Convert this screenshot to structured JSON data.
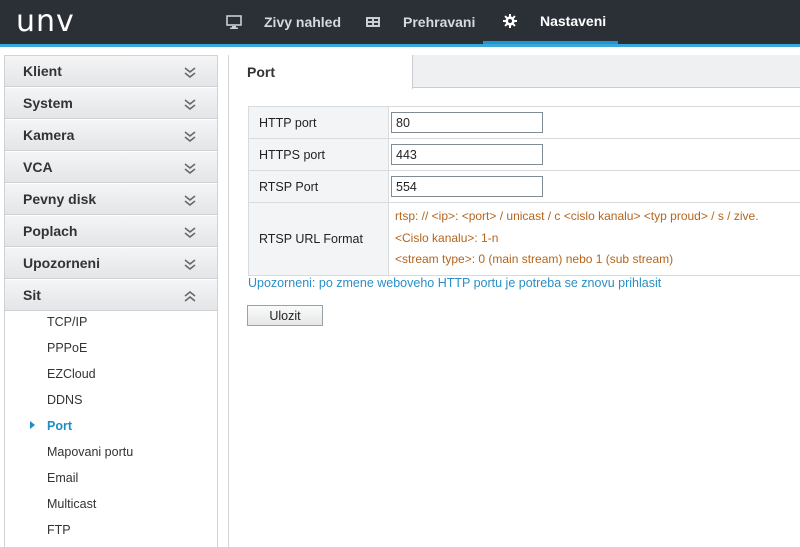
{
  "brand": {
    "logo": "unv"
  },
  "nav": [
    {
      "label": "Zivy nahled",
      "icon": "monitor-icon"
    },
    {
      "label": "Prehravani",
      "icon": "playback-icon"
    },
    {
      "label": "Nastaveni",
      "icon": "gear-icon",
      "active": true
    }
  ],
  "sidebar": {
    "menus": [
      "Klient",
      "System",
      "Kamera",
      "VCA",
      "Pevny disk",
      "Poplach",
      "Upozorneni",
      "Sit"
    ],
    "expanded": "Sit",
    "submenu": [
      "TCP/IP",
      "PPPoE",
      "EZCloud",
      "DDNS",
      "Port",
      "Mapovani portu",
      "Email",
      "Multicast",
      "FTP"
    ],
    "active_submenu": "Port"
  },
  "tab": {
    "label": "Port"
  },
  "form": {
    "http_label": "HTTP port",
    "http_value": "80",
    "https_label": "HTTPS port",
    "https_value": "443",
    "rtsp_label": "RTSP Port",
    "rtsp_value": "554",
    "rtsp_url_label": "RTSP URL Format",
    "rtsp_url_line1": "rtsp: // <ip>: <port> / unicast / c <cislo kanalu> <typ proud> / s / zive.",
    "rtsp_url_line2": "<Cislo kanalu>: 1-n",
    "rtsp_url_line3": "<stream type>: 0 (main stream) nebo 1 (sub stream)"
  },
  "warning": "Upozorneni: po zmene weboveho HTTP portu je potreba se znovu prihlasit",
  "save_label": "Ulozit",
  "colors": {
    "header_bg": "#2b2f36",
    "accent": "#1c97d4",
    "link": "#2a8fc6",
    "rtsp_text": "#b5651d"
  }
}
